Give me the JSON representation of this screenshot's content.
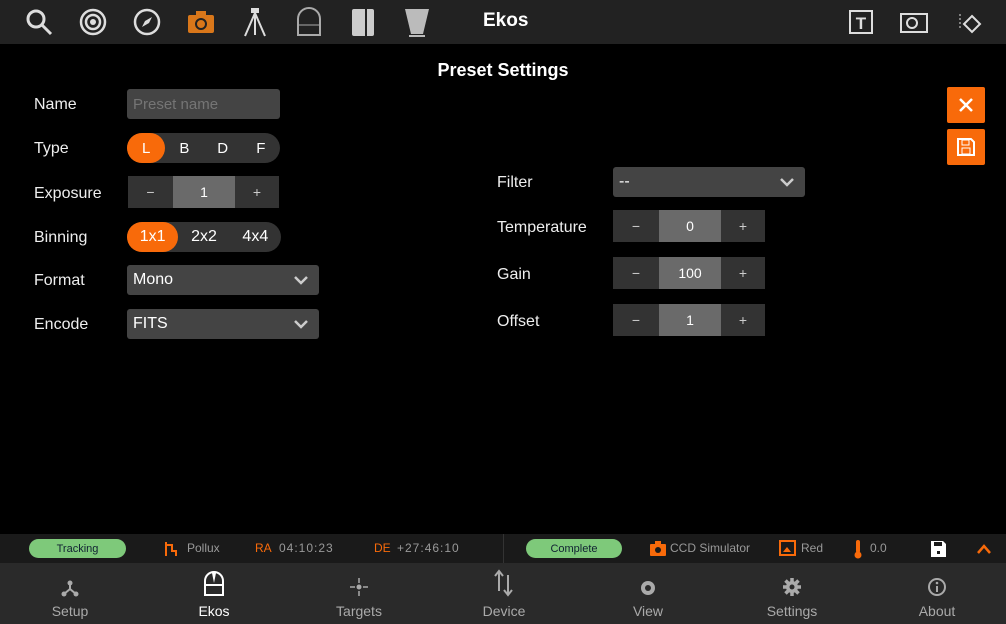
{
  "topbar": {
    "title": "Ekos",
    "accent": "#f86a0a"
  },
  "dialog": {
    "title": "Preset Settings",
    "name": {
      "label": "Name",
      "placeholder": "Preset name"
    },
    "type": {
      "label": "Type",
      "options": [
        "L",
        "B",
        "D",
        "F"
      ],
      "selected": "L"
    },
    "exposure": {
      "label": "Exposure",
      "value": "1",
      "minus": "−",
      "plus": "+"
    },
    "binning": {
      "label": "Binning",
      "options": [
        "1x1",
        "2x2",
        "4x4"
      ],
      "selected": "1x1"
    },
    "format": {
      "label": "Format",
      "value": "Mono"
    },
    "encode": {
      "label": "Encode",
      "value": "FITS"
    },
    "filter": {
      "label": "Filter",
      "value": "--"
    },
    "temperature": {
      "label": "Temperature",
      "value": "0"
    },
    "gain": {
      "label": "Gain",
      "value": "100"
    },
    "offset": {
      "label": "Offset",
      "value": "1"
    }
  },
  "status": {
    "mount_state": "Tracking",
    "target": "Pollux",
    "ra_label": "RA",
    "ra": "04:10:23",
    "de_label": "DE",
    "de": "+27:46:10",
    "capture_state": "Complete",
    "camera": "CCD Simulator",
    "filter": "Red",
    "temperature": "0.0"
  },
  "nav": [
    {
      "label": "Setup"
    },
    {
      "label": "Ekos"
    },
    {
      "label": "Targets"
    },
    {
      "label": "Device"
    },
    {
      "label": "View"
    },
    {
      "label": "Settings"
    },
    {
      "label": "About"
    }
  ]
}
